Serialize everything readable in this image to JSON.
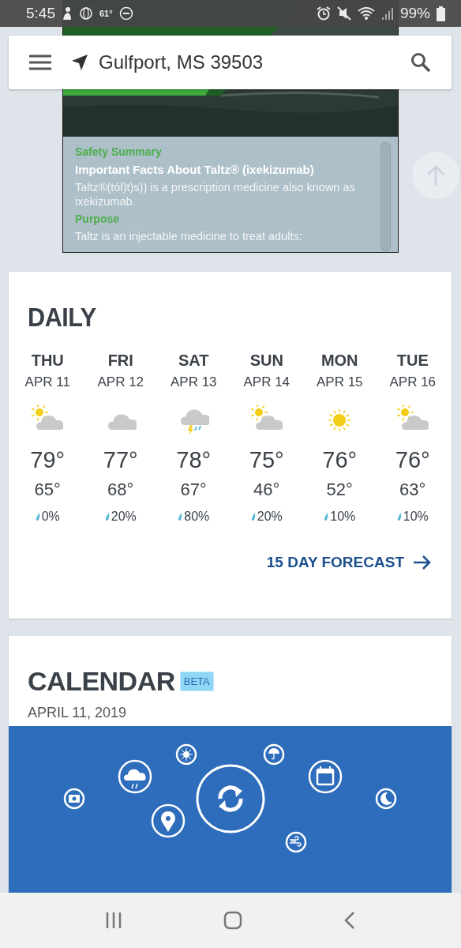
{
  "status_bar": {
    "time": "5:45",
    "temperature": "61°",
    "battery": "99%"
  },
  "ad": {
    "summary": [
      {
        "kind": "section",
        "text": "Safety Summary"
      },
      {
        "kind": "heading",
        "text": "Important Facts About Taltz® (ixekizumab)"
      },
      {
        "kind": "body",
        "text": "Taltz®(tól)t)s)) is a prescription medicine also known as ixekizumab."
      },
      {
        "kind": "section",
        "text": "Purpose"
      },
      {
        "kind": "body",
        "text": "Taltz is an injectable medicine to treat adults:"
      }
    ]
  },
  "search_bar": {
    "location": "Gulfport, MS 39503"
  },
  "daily": {
    "title": "DAILY",
    "days": [
      {
        "day": "THU",
        "date": "APR 11",
        "kind": "partly_cloudy",
        "high": "79°",
        "low": "65°",
        "precip": "0%"
      },
      {
        "day": "FRI",
        "date": "APR 12",
        "kind": "cloudy",
        "high": "77°",
        "low": "68°",
        "precip": "20%"
      },
      {
        "day": "SAT",
        "date": "APR 13",
        "kind": "thunderstorm",
        "high": "78°",
        "low": "67°",
        "precip": "80%"
      },
      {
        "day": "SUN",
        "date": "APR 14",
        "kind": "partly_cloudy",
        "high": "75°",
        "low": "46°",
        "precip": "20%"
      },
      {
        "day": "MON",
        "date": "APR 15",
        "kind": "sunny",
        "high": "76°",
        "low": "52°",
        "precip": "10%"
      },
      {
        "day": "TUE",
        "date": "APR 16",
        "kind": "partly_cloudy",
        "high": "76°",
        "low": "63°",
        "precip": "10%"
      }
    ],
    "link": "15 DAY FORECAST"
  },
  "calendar": {
    "title": "CALENDAR",
    "badge": "BETA",
    "date": "APRIL 11, 2019"
  }
}
